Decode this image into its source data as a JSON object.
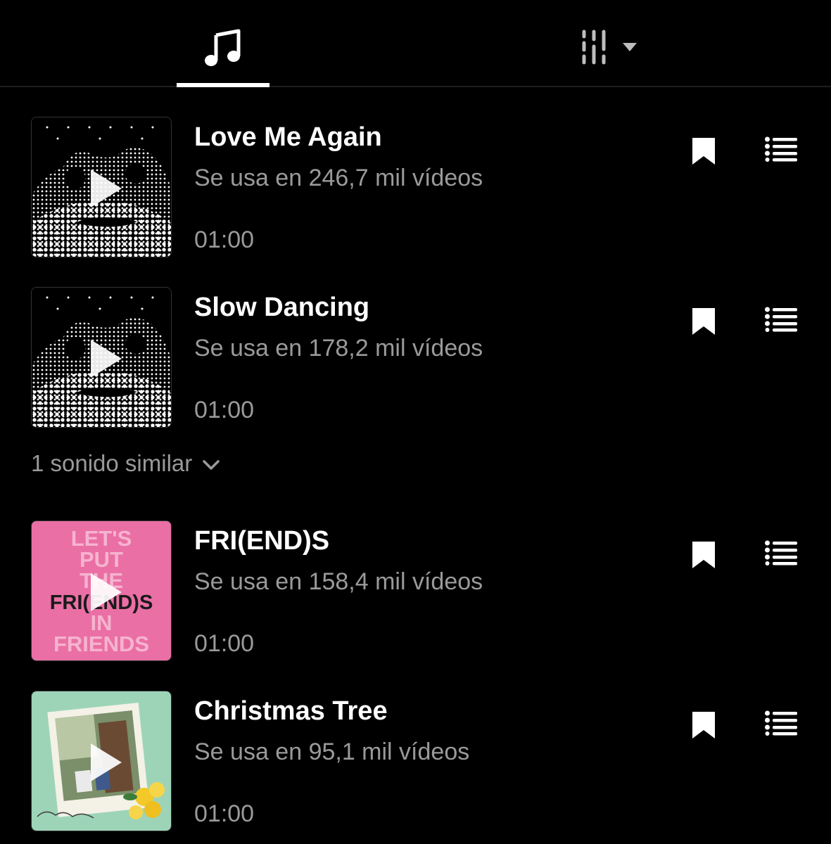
{
  "tabs": [
    {
      "icon": "music-note-icon",
      "selected": true
    },
    {
      "icon": "filter-bars-icon",
      "selected": false
    }
  ],
  "tracks": [
    {
      "title": "Love Me Again",
      "usage": "Se usa en 246,7 mil vídeos",
      "duration": "01:00",
      "cover": "halftone-face-art"
    },
    {
      "title": "Slow Dancing",
      "usage": "Se usa en 178,2 mil vídeos",
      "duration": "01:00",
      "cover": "halftone-face-art"
    },
    {
      "title": "FRI(END)S",
      "usage": "Se usa en 158,4 mil vídeos",
      "duration": "01:00",
      "cover": "pink-text-art"
    },
    {
      "title": "Christmas Tree",
      "usage": "Se usa en 95,1 mil vídeos",
      "duration": "01:00",
      "cover": "green-photo-art"
    }
  ],
  "similar": {
    "label": "1 sonido similar"
  },
  "friends_cover": {
    "lines": [
      "LET'S",
      "PUT",
      "THE",
      "FRI(END)S",
      "IN",
      "FRIENDS"
    ]
  },
  "colors": {
    "background": "#000000",
    "secondary_text": "#9a9a9a",
    "pink_cover": "#ea6fa5",
    "green_cover": "#9dd4b8"
  }
}
